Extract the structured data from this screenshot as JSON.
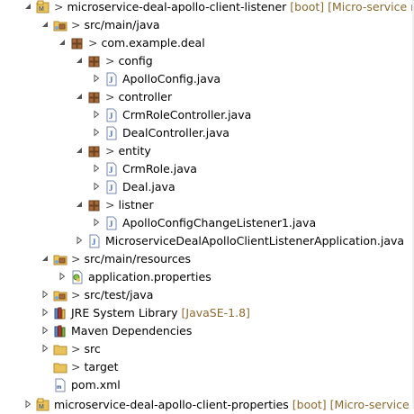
{
  "project_explorer": {
    "items": [
      {
        "label": "microservice-deal-apollo-client-listener",
        "decoration": "[boot] [Micro-service maste",
        "prefix": ">",
        "icon": "maven-project-icon",
        "expanded": true
      },
      {
        "label": "src/main/java",
        "prefix": ">",
        "icon": "source-folder-icon",
        "expanded": true
      },
      {
        "label": "com.example.deal",
        "prefix": ">",
        "icon": "package-icon",
        "expanded": true
      },
      {
        "label": "config",
        "prefix": ">",
        "icon": "package-icon",
        "expanded": true
      },
      {
        "label": "ApolloConfig.java",
        "prefix": "",
        "icon": "java-file-icon",
        "expanded": false
      },
      {
        "label": "controller",
        "prefix": ">",
        "icon": "package-icon",
        "expanded": true
      },
      {
        "label": "CrmRoleController.java",
        "prefix": "",
        "icon": "java-file-icon",
        "expanded": false
      },
      {
        "label": "DealController.java",
        "prefix": "",
        "icon": "java-file-icon",
        "expanded": false
      },
      {
        "label": "entity",
        "prefix": ">",
        "icon": "package-icon",
        "expanded": true
      },
      {
        "label": "CrmRole.java",
        "prefix": "",
        "icon": "java-file-icon",
        "expanded": false
      },
      {
        "label": "Deal.java",
        "prefix": "",
        "icon": "java-file-icon",
        "expanded": false
      },
      {
        "label": "listner",
        "prefix": ">",
        "icon": "package-icon",
        "expanded": true
      },
      {
        "label": "ApolloConfigChangeListener1.java",
        "prefix": "",
        "icon": "java-file-icon",
        "expanded": false
      },
      {
        "label": "MicroserviceDealApolloClientListenerApplication.java",
        "prefix": "",
        "icon": "java-file-icon",
        "expanded": false
      },
      {
        "label": "src/main/resources",
        "prefix": ">",
        "icon": "source-folder-icon",
        "expanded": true
      },
      {
        "label": "application.properties",
        "prefix": "",
        "icon": "properties-file-icon",
        "expanded": false
      },
      {
        "label": "src/test/java",
        "prefix": ">",
        "icon": "source-folder-icon",
        "expanded": false
      },
      {
        "label": "JRE System Library",
        "decoration": "[JavaSE-1.8]",
        "prefix": "",
        "icon": "library-icon",
        "expanded": false
      },
      {
        "label": "Maven Dependencies",
        "prefix": "",
        "icon": "maven-library-icon",
        "expanded": false
      },
      {
        "label": "src",
        "prefix": ">",
        "icon": "folder-icon",
        "expanded": false
      },
      {
        "label": "target",
        "prefix": ">",
        "icon": "folder-icon",
        "expanded": null
      },
      {
        "label": "pom.xml",
        "prefix": "",
        "icon": "xml-file-icon",
        "expanded": null
      },
      {
        "label": "microservice-deal-apollo-client-properties",
        "decoration": "[boot] [Micro-service maste",
        "prefix": "",
        "icon": "maven-project-icon",
        "expanded": false
      }
    ]
  },
  "colors": {
    "decoration": "#8a6a32",
    "folder": "#e8c25a",
    "package": "#a6693a",
    "java": "#3d6bbf",
    "twisty": "#555555"
  }
}
